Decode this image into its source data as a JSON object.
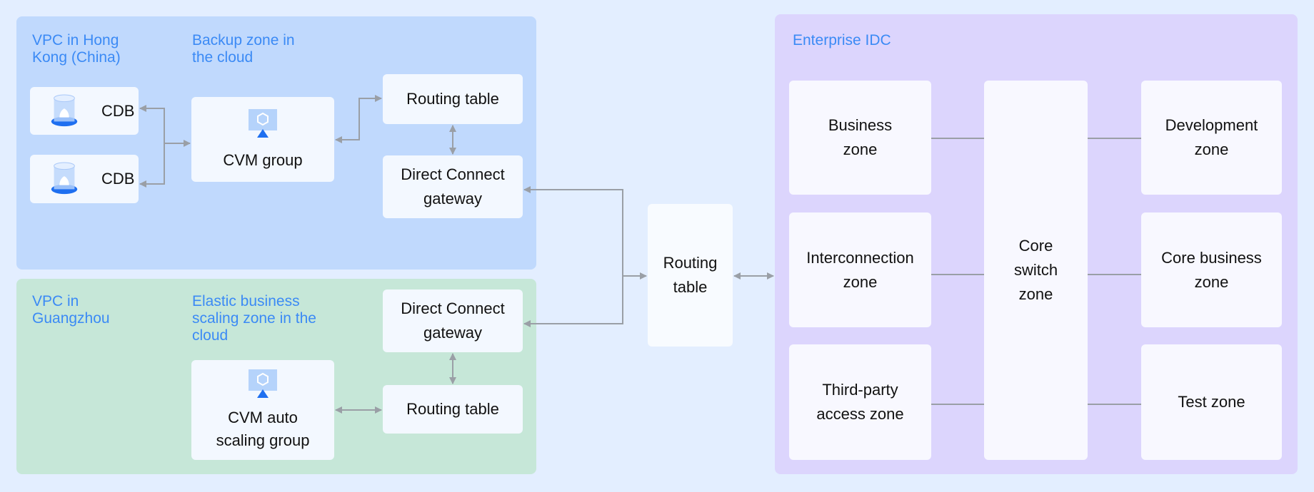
{
  "hk": {
    "vpc_label": "VPC in Hong Kong (China)",
    "zone_label": "Backup zone in the cloud",
    "cdb1": "CDB",
    "cdb2": "CDB",
    "cvm": "CVM group",
    "routing": "Routing table",
    "dc": "Direct Connect gateway"
  },
  "gz": {
    "vpc_label": "VPC in Guangzhou",
    "zone_label": "Elastic business scaling zone in the cloud",
    "dc": "Direct Connect gateway",
    "routing": "Routing table",
    "cvm": "CVM auto scaling group"
  },
  "center": {
    "routing": "Routing table"
  },
  "idc": {
    "label": "Enterprise IDC",
    "business": "Business zone",
    "interconnection": "Interconnection zone",
    "third_party": "Third-party access zone",
    "core_switch": "Core switch zone",
    "development": "Development zone",
    "core_business": "Core business zone",
    "test": "Test zone"
  },
  "colors": {
    "hk_panel": "#c0d9fd",
    "gz_panel": "#c6e7d8",
    "idc_panel": "#dcd5fd",
    "label": "#3b8af5",
    "wire": "#9a9fa6",
    "icon": "#1e6ff0"
  }
}
